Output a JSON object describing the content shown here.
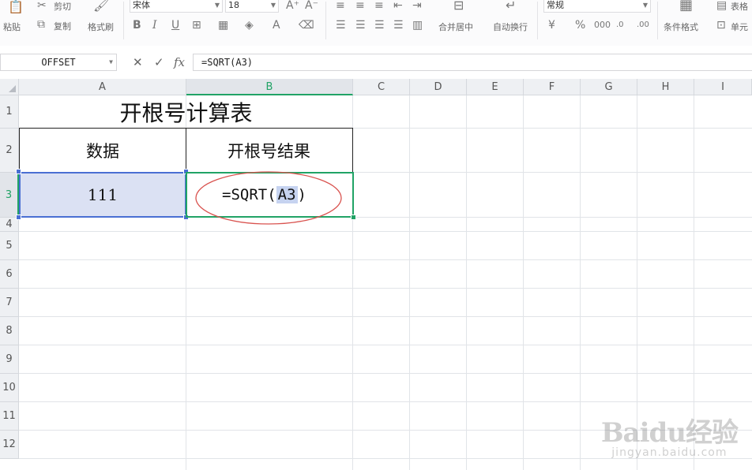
{
  "ribbon": {
    "paste_label": "粘贴",
    "cut_label": "剪切",
    "copy_label": "复制",
    "format_painter_label": "格式刷",
    "font_name": "宋体",
    "font_size": "18",
    "merge_center_label": "合并居中",
    "wrap_text_label": "自动换行",
    "number_format": "常规",
    "conditional_format_label": "条件格式",
    "table_style_label": "表格",
    "cell_label": "单元"
  },
  "formula_bar": {
    "name_box": "OFFSET",
    "fx_label": "fx",
    "formula": "=SQRT(A3)"
  },
  "columns": [
    "A",
    "B",
    "C",
    "D",
    "E",
    "F",
    "G",
    "H",
    "I"
  ],
  "rows": [
    "1",
    "2",
    "3",
    "4",
    "5",
    "6",
    "7",
    "8",
    "9",
    "10",
    "11",
    "12"
  ],
  "active": {
    "column": "B",
    "row": "3"
  },
  "cells": {
    "title": "开根号计算表",
    "header_data": "数据",
    "header_result": "开根号结果",
    "value": "111",
    "formula_prefix": "=SQRT(",
    "formula_ref": "A3",
    "formula_suffix": ")"
  },
  "colors": {
    "accent_green": "#21a366",
    "selection_blue": "#4a6fd3",
    "ref_highlight": "#c6d3f0",
    "annotation_red": "#d9534f"
  },
  "watermark": {
    "logo": "Baidu经验",
    "url": "jingyan.baidu.com"
  }
}
